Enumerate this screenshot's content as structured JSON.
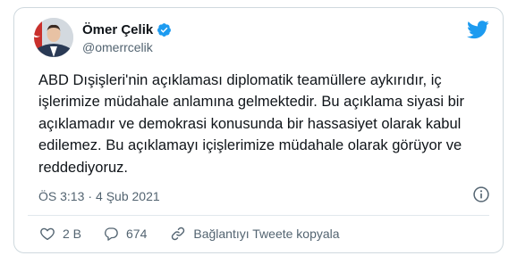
{
  "author": {
    "display_name": "Ömer Çelik",
    "handle": "@omerrcelik",
    "verified": true
  },
  "tweet": {
    "text": "ABD Dışişleri'nin açıklaması diplomatik teamüllere aykırıdır,  iç işlerimize müdahale anlamına gelmektedir. Bu açıklama siyasi bir açıklamadır ve demokrasi konusunda bir hassasiyet olarak kabul edilemez. Bu açıklamayı içişlerimize müdahale olarak görüyor ve reddediyoruz.",
    "time": "ÖS 3:13",
    "separator": "·",
    "date": "4 Şub 2021"
  },
  "actions": {
    "likes": "2 B",
    "replies": "674",
    "copy_link": "Bağlantıyı Tweete kopyala"
  },
  "icons": {
    "brand": "twitter-bird-icon",
    "verified": "verified-badge-icon",
    "info": "info-icon",
    "like": "heart-icon",
    "reply": "reply-bubble-icon",
    "copy_link": "link-icon"
  },
  "colors": {
    "twitter_blue": "#1d9bf0",
    "text_primary": "#0f1419",
    "text_secondary": "#536471",
    "border": "#cfd9de"
  }
}
